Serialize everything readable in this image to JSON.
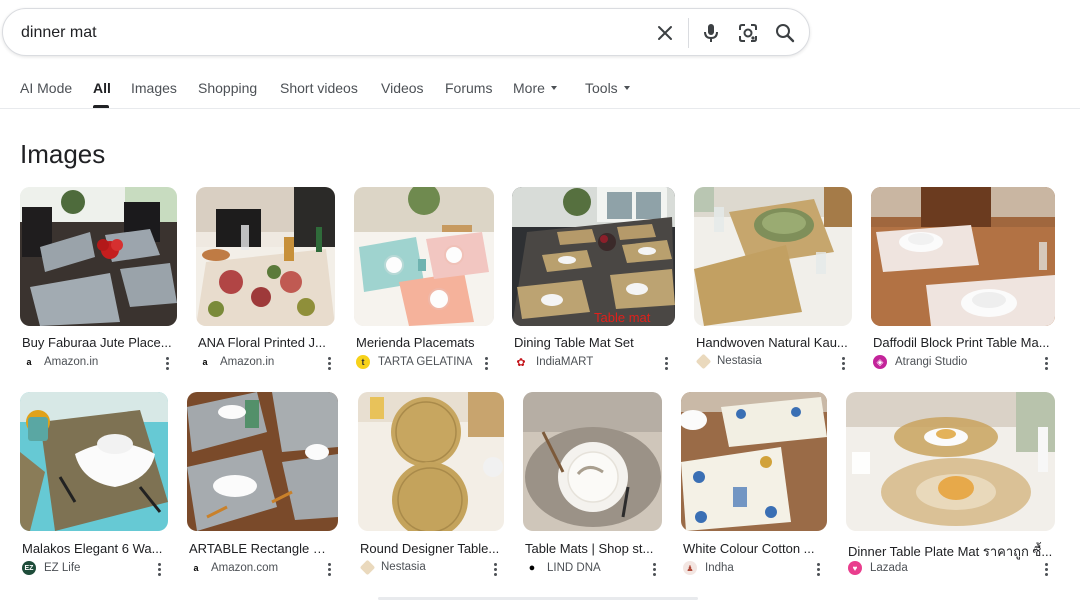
{
  "search": {
    "query": "dinner mat"
  },
  "tabs": [
    {
      "label": "AI Mode"
    },
    {
      "label": "All"
    },
    {
      "label": "Images"
    },
    {
      "label": "Shopping"
    },
    {
      "label": "Short videos"
    },
    {
      "label": "Videos"
    },
    {
      "label": "Forums"
    },
    {
      "label": "More"
    },
    {
      "label": "Tools"
    }
  ],
  "active_tab": "All",
  "section": {
    "title": "Images"
  },
  "results": [
    {
      "title": "Buy Faburaa Jute Place...",
      "source": "Amazon.in",
      "favicon": "amazon-icon"
    },
    {
      "title": "ANA Floral Printed J...",
      "source": "Amazon.in",
      "favicon": "amazon-icon"
    },
    {
      "title": "Merienda Placemats",
      "source": "TARTA GELATINA",
      "favicon": "tarta-gelatina-icon"
    },
    {
      "title": "Dining Table Mat Set",
      "source": "IndiaMART",
      "favicon": "indiamart-icon",
      "overlay_text": "Table mat"
    },
    {
      "title": "Handwoven Natural Kau...",
      "source": "Nestasia",
      "favicon": "nestasia-icon"
    },
    {
      "title": "Daffodil Block Print Table Ma...",
      "source": "Atrangi Studio",
      "favicon": "atrangi-icon"
    },
    {
      "title": "Malakos Elegant 6 Wa...",
      "source": "EZ Life",
      "favicon": "ezlife-icon"
    },
    {
      "title": "ARTABLE Rectangle Pl...",
      "source": "Amazon.com",
      "favicon": "amazon-icon"
    },
    {
      "title": "Round Designer Table...",
      "source": "Nestasia",
      "favicon": "nestasia-icon"
    },
    {
      "title": "Table Mats | Shop st...",
      "source": "LIND DNA",
      "favicon": "lind-dna-icon"
    },
    {
      "title": "White Colour Cotton ...",
      "source": "Indha",
      "favicon": "indha-icon"
    },
    {
      "title": "Dinner Table Plate Mat ราคาถูก ซื้...",
      "source": "Lazada",
      "favicon": "lazada-icon"
    }
  ],
  "colors": {
    "text_primary": "#202124",
    "text_secondary": "#4d5156",
    "border": "#dadce0",
    "overlay_red": "#e0201b"
  }
}
